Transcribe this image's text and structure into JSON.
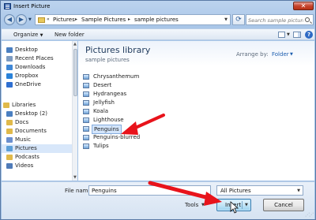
{
  "window": {
    "title": "Insert Picture",
    "close_glyph": "✕"
  },
  "address_bar": {
    "history_glyph": "«",
    "crumbs": [
      "Pictures",
      "Sample Pictures",
      "sample pictures"
    ],
    "separator": "▸",
    "search_placeholder": "Search sample pictures"
  },
  "toolbar": {
    "organize_label": "Organize",
    "new_folder_label": "New folder",
    "help_glyph": "?"
  },
  "nav_pane": {
    "items": [
      {
        "label": "Desktop",
        "icon": "desktop-icon",
        "color": "#4a7fc1",
        "selected": false
      },
      {
        "label": "Recent Places",
        "icon": "recent-places-icon",
        "color": "#7c9bc2",
        "selected": false
      },
      {
        "label": "Downloads",
        "icon": "downloads-icon",
        "color": "#3f87d6",
        "selected": false
      },
      {
        "label": "Dropbox",
        "icon": "dropbox-icon",
        "color": "#2a82d9",
        "selected": false
      },
      {
        "label": "OneDrive",
        "icon": "onedrive-icon",
        "color": "#2f6fd1",
        "selected": false
      },
      {
        "label": "Libraries",
        "icon": "libraries-icon",
        "color": "#e0b94a",
        "selected": false
      },
      {
        "label": "Desktop (2)",
        "icon": "desktop-icon",
        "color": "#4a7fc1",
        "selected": false
      },
      {
        "label": "Docs",
        "icon": "docs-icon",
        "color": "#e0b94a",
        "selected": false
      },
      {
        "label": "Documents",
        "icon": "documents-icon",
        "color": "#e0b94a",
        "selected": false
      },
      {
        "label": "Music",
        "icon": "music-icon",
        "color": "#6a8fcf",
        "selected": false
      },
      {
        "label": "Pictures",
        "icon": "pictures-icon",
        "color": "#5c9fd8",
        "selected": true
      },
      {
        "label": "Podcasts",
        "icon": "podcasts-icon",
        "color": "#e0b94a",
        "selected": false
      },
      {
        "label": "Videos",
        "icon": "videos-icon",
        "color": "#4f7bb8",
        "selected": false
      }
    ]
  },
  "library": {
    "title": "Pictures library",
    "subtitle": "sample pictures",
    "arrange_label": "Arrange by:",
    "arrange_value": "Folder"
  },
  "files": [
    {
      "name": "Chrysanthemum",
      "selected": false
    },
    {
      "name": "Desert",
      "selected": false
    },
    {
      "name": "Hydrangeas",
      "selected": false
    },
    {
      "name": "Jellyfish",
      "selected": false
    },
    {
      "name": "Koala",
      "selected": false
    },
    {
      "name": "Lighthouse",
      "selected": false
    },
    {
      "name": "Penguins",
      "selected": true
    },
    {
      "name": "Penguins-blurred",
      "selected": false
    },
    {
      "name": "Tulips",
      "selected": false
    }
  ],
  "footer": {
    "file_name_label": "File name:",
    "file_name_value": "Penguins",
    "filter_value": "All Pictures",
    "tools_label": "Tools",
    "insert_label": "Insert",
    "cancel_label": "Cancel"
  },
  "annotation_color": "#e8131b"
}
